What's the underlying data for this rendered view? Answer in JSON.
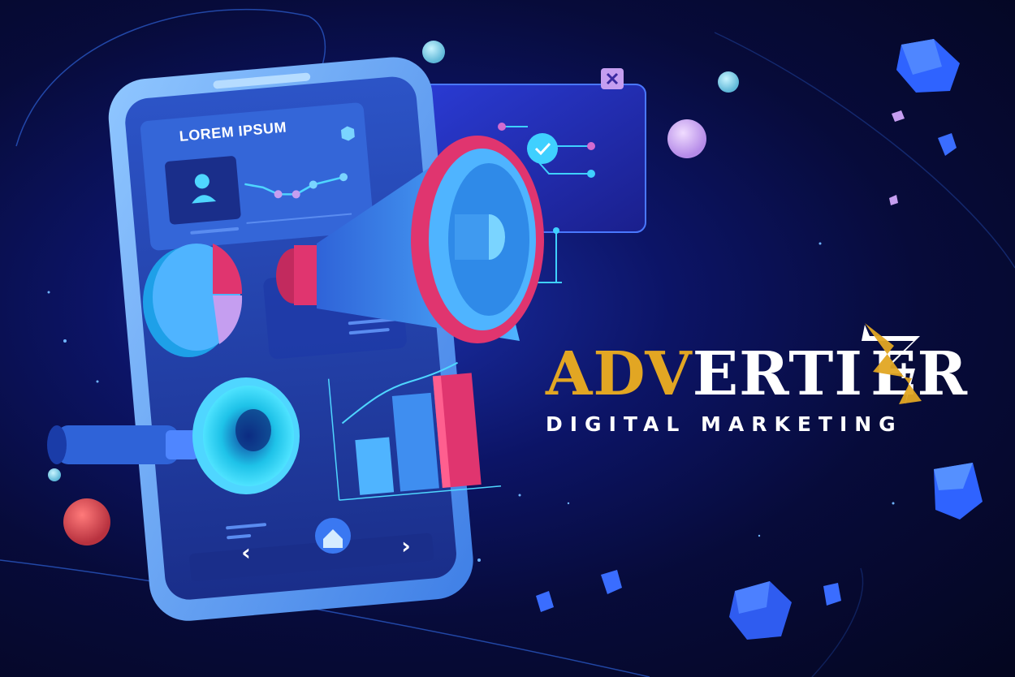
{
  "brand": {
    "logo": {
      "highlight": "ADV",
      "middle": "ERTI",
      "stylized_letter": "Z",
      "tail": "ER",
      "highlight_color": "#e2a623",
      "text_color": "#ffffff"
    },
    "tagline": "DIGITAL MARKETING"
  },
  "phone": {
    "screen_title": "LOREM IPSUM",
    "nav": {
      "back": "‹",
      "home_icon": "home-icon",
      "forward": "›"
    }
  },
  "popup": {
    "close_icon": "close-icon",
    "check_icon": "check-icon"
  },
  "palette": {
    "background": "#070b3a",
    "accent_blue": "#3fa0ff",
    "accent_pink": "#e0356f",
    "accent_purple": "#c59ef0",
    "gold": "#e2a623"
  }
}
